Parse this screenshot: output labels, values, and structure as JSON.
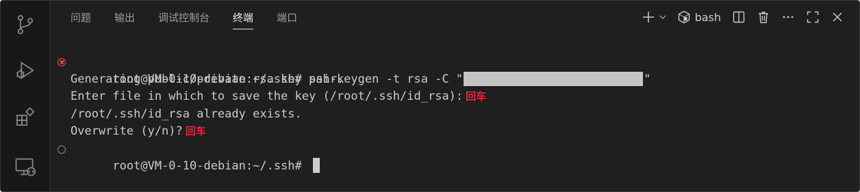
{
  "activity_bar": {
    "items": [
      {
        "icon": "source-control-icon"
      },
      {
        "icon": "run-debug-icon"
      },
      {
        "icon": "extensions-icon"
      },
      {
        "icon": "remote-explorer-icon"
      }
    ]
  },
  "panel": {
    "tabs": [
      {
        "label": "问题"
      },
      {
        "label": "输出"
      },
      {
        "label": "调试控制台"
      },
      {
        "label": "终端",
        "active": true
      },
      {
        "label": "端口"
      }
    ],
    "toolbar": {
      "new_terminal_icon": "plus-icon",
      "dropdown_icon": "chevron-down-icon",
      "shell_icon": "bash-shell-icon",
      "shell_label": "bash",
      "split_icon": "split-editor-icon",
      "kill_icon": "trash-icon",
      "more_icon": "ellipsis-icon",
      "maximize_icon": "maximize-icon",
      "close_icon": "close-icon"
    }
  },
  "terminal": {
    "lines": [
      {
        "text": "root@VM-0-10-debian:~/.ssh# ssh-keygen -t rsa -C \"",
        "suffix": "\"",
        "redacted": true,
        "decoration": "error"
      },
      {
        "text": "Generating public/private rsa key pair."
      },
      {
        "text": "Enter file in which to save the key (/root/.ssh/id_rsa):",
        "annotation": "回车"
      },
      {
        "text": "/root/.ssh/id_rsa already exists."
      },
      {
        "text": "Overwrite (y/n)?",
        "annotation": "回车"
      },
      {
        "text": "root@VM-0-10-debian:~/.ssh# ",
        "decoration": "idle",
        "cursor": true
      }
    ]
  },
  "colors": {
    "background": "#1f1f1f",
    "activity_bar": "#181818",
    "text": "#cccccc",
    "annotation": "#f0233a",
    "error_decoration": "#f14c4c"
  }
}
